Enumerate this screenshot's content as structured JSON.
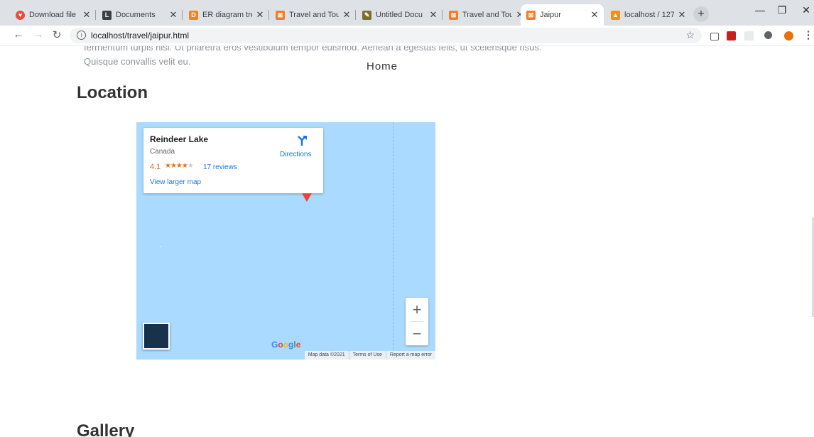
{
  "browser": {
    "tabs": [
      {
        "title": "Download file",
        "favicon": "heart-icon",
        "color": "#e84c3d"
      },
      {
        "title": "Documents",
        "favicon": "docs-icon",
        "color": "#3c4043"
      },
      {
        "title": "ER diagram tre",
        "favicon": "diagram-icon",
        "color": "#f4811f"
      },
      {
        "title": "Travel and Tou",
        "favicon": "xampp-icon",
        "color": "#fb7a24"
      },
      {
        "title": "Untitled Docu",
        "favicon": "doc-icon",
        "color": "#7b6f2d"
      },
      {
        "title": "Travel and Tou",
        "favicon": "xampp-icon",
        "color": "#fb7a24"
      },
      {
        "title": "Jaipur",
        "favicon": "xampp-icon",
        "color": "#fb7a24"
      },
      {
        "title": "localhost / 127",
        "favicon": "phpmyadmin-icon",
        "color": "#f29111"
      }
    ],
    "url": "localhost/travel/jaipur.html"
  },
  "page": {
    "lorem_line1": "fermentum turpis nisl. Ut pharetra eros vestibulum tempor euismod. Aenean a egestas felis, ut scelerisque risus.",
    "lorem_line2": "Quisque convallis velit eu.",
    "home": "Home",
    "location_heading": "Location",
    "gallery_heading": "Gallery"
  },
  "map": {
    "place_name": "Reindeer Lake",
    "country": "Canada",
    "rating": "4.1",
    "stars_filled": 4,
    "stars_total": 5,
    "reviews": "17 reviews",
    "directions": "Directions",
    "view_larger": "View larger map",
    "zoom_in": "+",
    "zoom_out": "−",
    "google_logo": "Google",
    "attribution": [
      "Map data ©2021",
      "Terms of Use",
      "Report a map error"
    ],
    "colors": {
      "water": "#aadaff",
      "pin": "#ea4335",
      "link": "#1a73e8",
      "rating": "#e7711b"
    }
  }
}
